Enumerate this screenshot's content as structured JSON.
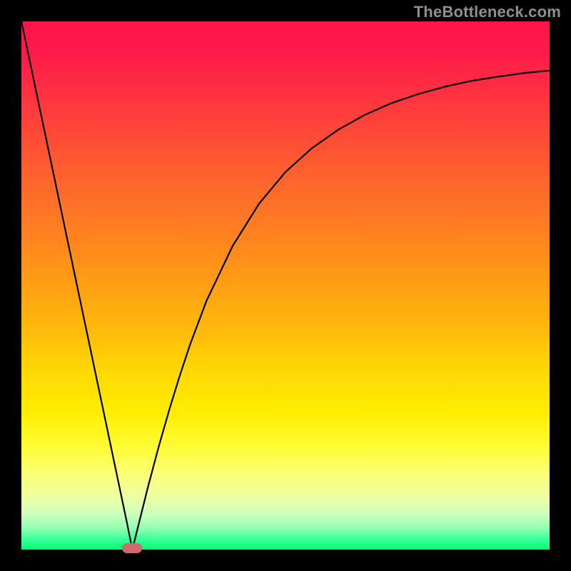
{
  "watermark": "TheBottleneck.com",
  "colors": {
    "frame": "#000000",
    "curve": "#000000",
    "marker": "#d16a6f",
    "watermark": "#8f8f8f",
    "gradient_top": "#ff1449",
    "gradient_bottom": "#00ff6a"
  },
  "chart_data": {
    "type": "line",
    "title": "",
    "xlabel": "",
    "ylabel": "",
    "xlim": [
      0,
      100
    ],
    "ylim": [
      0,
      100
    ],
    "grid": false,
    "legend": false,
    "x": [
      0,
      2,
      4,
      6,
      8,
      10,
      12,
      14,
      16,
      18,
      20,
      21,
      22,
      24,
      26,
      28,
      30,
      32,
      35,
      40,
      45,
      50,
      55,
      60,
      65,
      70,
      75,
      80,
      85,
      90,
      95,
      100
    ],
    "y": [
      100,
      90.5,
      81,
      71.5,
      62,
      52.5,
      43,
      33.5,
      24,
      14.5,
      5,
      0,
      4,
      12,
      19.5,
      26.5,
      33,
      39,
      47,
      57.5,
      65.5,
      71.5,
      76,
      79.5,
      82.3,
      84.5,
      86.2,
      87.6,
      88.7,
      89.5,
      90.2,
      90.7
    ],
    "marker": {
      "x": 21,
      "y": 0
    },
    "note": "Axis values are percentages of plot width/height; curve read off pixels — x measured left→right, y measured bottom→top."
  }
}
